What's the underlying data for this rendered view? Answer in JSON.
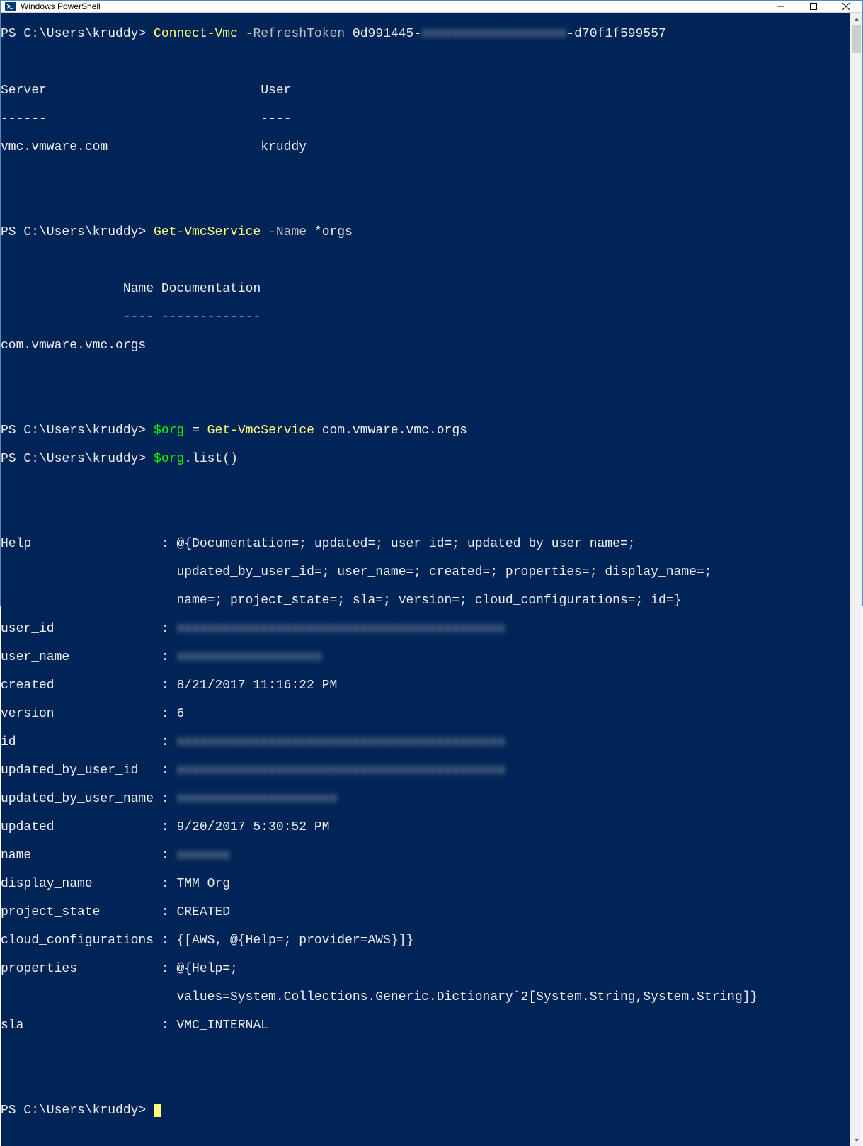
{
  "window": {
    "title": "Windows PowerShell"
  },
  "prompt": "PS C:\\Users\\kruddy> ",
  "cmd1": {
    "cmd": "Connect-Vmc",
    "param": " -RefreshToken",
    "val_pre": " 0d991445-",
    "val_blur": "xxxxxxxxxxxxxxxxxxx",
    "val_post": "-d70f1f599557"
  },
  "out1": {
    "hdr": "Server                            User",
    "sep": "------                            ----",
    "row": "vmc.vmware.com                    kruddy"
  },
  "cmd2": {
    "cmd": "Get-VmcService",
    "param": " -Name",
    "val": " *orgs"
  },
  "out2": {
    "hdr": "                Name Documentation",
    "sep": "                ---- -------------",
    "row": "com.vmware.vmc.orgs"
  },
  "cmd3": {
    "var": "$org",
    "eq": " = ",
    "cmd": "Get-VmcService",
    "arg": " com.vmware.vmc.orgs"
  },
  "cmd4": {
    "var": "$org",
    "rest": ".list()"
  },
  "result": {
    "help1": "Help                 : @{Documentation=; updated=; user_id=; updated_by_user_name=;",
    "help2": "                       updated_by_user_id=; user_name=; created=; properties=; display_name=;",
    "help3": "                       name=; project_state=; sla=; version=; cloud_configurations=; id=}",
    "user_id_k": "user_id              : ",
    "user_name_k": "user_name            : ",
    "created": "created              : 8/21/2017 11:16:22 PM",
    "version": "version              : 6",
    "id_k": "id                   : ",
    "upd_by_id_k": "updated_by_user_id   : ",
    "upd_by_name_k": "updated_by_user_name : ",
    "updated": "updated              : 9/20/2017 5:30:52 PM",
    "name_k": "name                 : ",
    "display_name": "display_name         : TMM Org",
    "project_state": "project_state        : CREATED",
    "cloud_cfg": "cloud_configurations : {[AWS, @{Help=; provider=AWS}]}",
    "props1": "properties           : @{Help=;",
    "props2": "                       values=System.Collections.Generic.Dictionary`2[System.String,System.String]}",
    "sla": "sla                  : VMC_INTERNAL",
    "blur_long1": "xxxxxxxxxxxxxxxxxxxxxxxxxxxxxxxxxxxxxxxxxxx",
    "blur_short": "xxxxxxxxxxxxxxxxxxx",
    "blur_med": "xxxxxxxxxxxxxxxxxxxxx",
    "blur_tiny": "xxxxxxx"
  }
}
